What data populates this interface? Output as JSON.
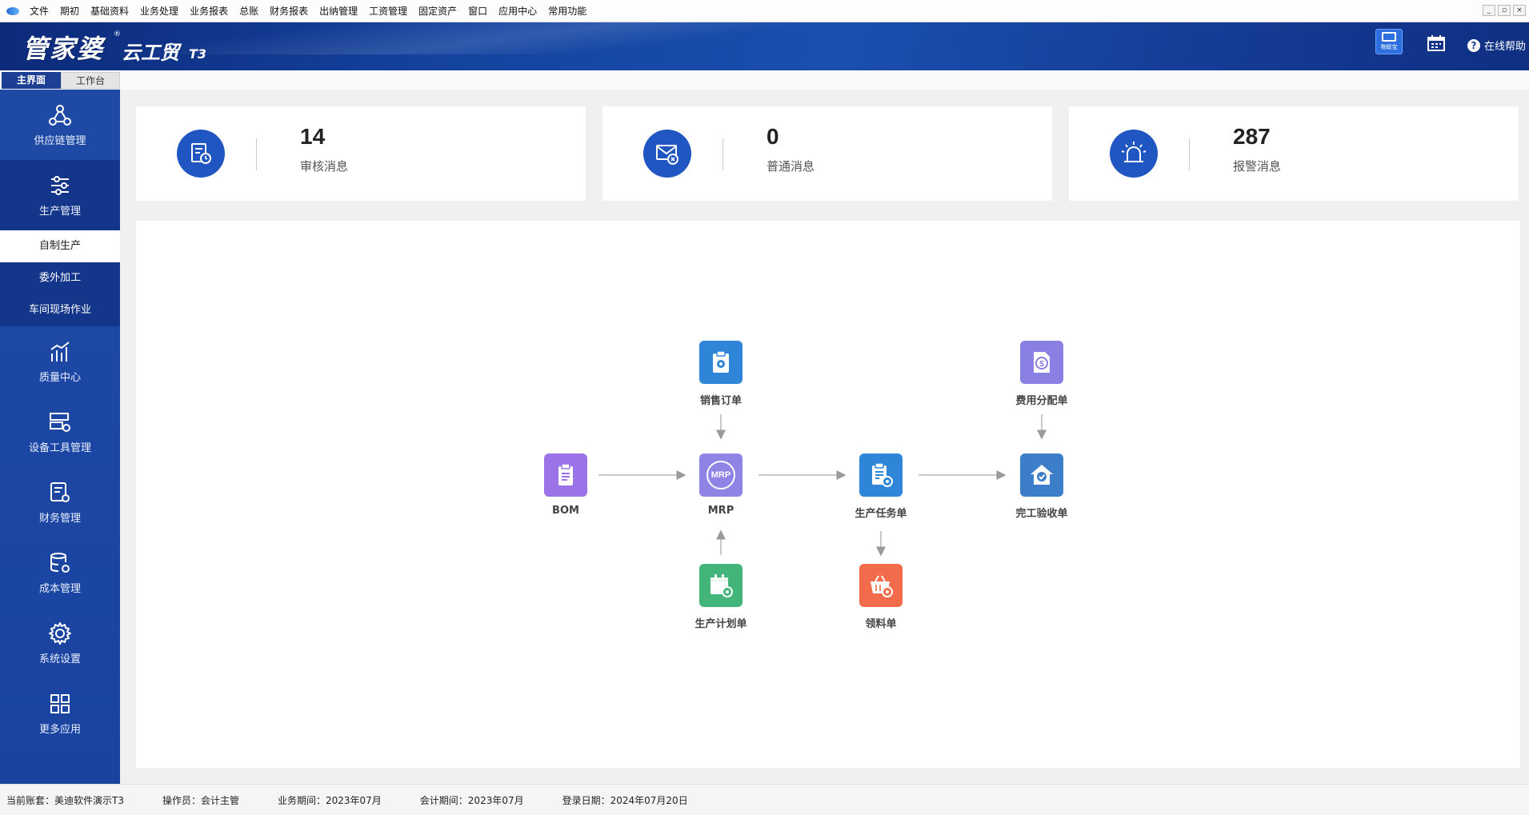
{
  "menu": [
    "文件",
    "期初",
    "基础资料",
    "业务处理",
    "业务报表",
    "总账",
    "财务报表",
    "出纳管理",
    "工资管理",
    "固定资产",
    "窗口",
    "应用中心",
    "常用功能"
  ],
  "window_buttons": [
    "_",
    "▫",
    "×"
  ],
  "header": {
    "logo_main": "管家婆",
    "logo_reg": "®",
    "logo_sub": "云工贸",
    "logo_version": "T3",
    "iot_badge": "物联宝",
    "help": "在线帮助"
  },
  "tabs": [
    "主界面",
    "工作台"
  ],
  "sidebar": {
    "items": [
      {
        "label": "供应链管理",
        "icon": "supply-chain-icon"
      },
      {
        "label": "生产管理",
        "icon": "sliders-icon"
      },
      {
        "label": "质量中心",
        "icon": "bar-chart-icon"
      },
      {
        "label": "设备工具管理",
        "icon": "device-settings-icon"
      },
      {
        "label": "财务管理",
        "icon": "finance-icon"
      },
      {
        "label": "成本管理",
        "icon": "database-settings-icon"
      },
      {
        "label": "系统设置",
        "icon": "gear-icon"
      },
      {
        "label": "更多应用",
        "icon": "grid-icon"
      }
    ],
    "sub_items": [
      "自制生产",
      "委外加工",
      "车间现场作业"
    ]
  },
  "stats": [
    {
      "value": "14",
      "label": "审核消息",
      "icon": "audit-message-icon"
    },
    {
      "value": "0",
      "label": "普通消息",
      "icon": "mail-icon"
    },
    {
      "value": "287",
      "label": "报警消息",
      "icon": "alarm-icon"
    }
  ],
  "flow": {
    "nodes": {
      "sales_order": {
        "label": "销售订单",
        "color": "#2f86d8",
        "icon": "clipboard-tag-icon"
      },
      "bom": {
        "label": "BOM",
        "color": "#9b72e8",
        "icon": "clipboard-icon"
      },
      "mrp": {
        "label": "MRP",
        "color": "#8f83e6",
        "icon": "mrp-icon"
      },
      "production_task": {
        "label": "生产任务单",
        "color": "#2f86d8",
        "icon": "document-gear-icon"
      },
      "cost_allocation": {
        "label": "费用分配单",
        "color": "#8a7fe3",
        "icon": "dollar-document-icon"
      },
      "completion_acceptance": {
        "label": "完工验收单",
        "color": "#3d7ecb",
        "icon": "house-check-icon"
      },
      "production_plan": {
        "label": "生产计划单",
        "color": "#43b57a",
        "icon": "calendar-gear-icon"
      },
      "material_requisition": {
        "label": "领料单",
        "color": "#f26b4b",
        "icon": "basket-gear-icon"
      }
    },
    "mrp_badge": "MRP"
  },
  "status": {
    "account": "当前账套：美迪软件演示T3",
    "operator": "操作员：会计主管",
    "business_period": "业务期间：2023年07月",
    "accounting_period": "会计期间：2023年07月",
    "login_date": "登录日期：2024年07月20日"
  }
}
